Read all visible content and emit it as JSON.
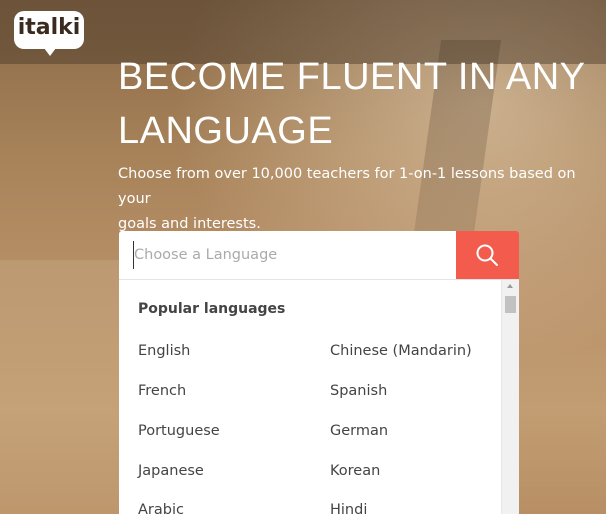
{
  "header": {
    "logo_text": "italki"
  },
  "hero": {
    "title_line1": "BECOME FLUENT IN ANY",
    "title_line2": "LANGUAGE",
    "subtitle_line1": "Choose from over 10,000 teachers for 1-on-1 lessons based on your",
    "subtitle_line2": "goals and interests."
  },
  "search": {
    "placeholder": "Choose a Language",
    "value": "",
    "button_icon": "search-icon",
    "button_color": "#f35b4d"
  },
  "dropdown": {
    "heading": "Popular languages",
    "languages": [
      "English",
      "Chinese (Mandarin)",
      "French",
      "Spanish",
      "Portuguese",
      "German",
      "Japanese",
      "Korean",
      "Arabic",
      "Hindi"
    ]
  }
}
